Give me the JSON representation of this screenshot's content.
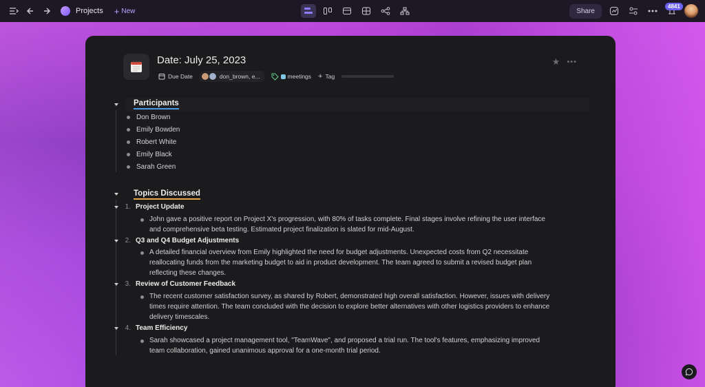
{
  "topbar": {
    "project_label": "Projects",
    "new_label": "New",
    "share_label": "Share",
    "notification_count": "4841"
  },
  "document": {
    "title": "Date: July 25, 2023",
    "properties": {
      "due_date_label": "Due Date",
      "assignees_label": "don_brown, e...",
      "tag_value": "meetings",
      "add_tag_label": "Tag"
    },
    "sections": [
      {
        "heading": "Participants",
        "items": [
          "Don Brown",
          "Emily Bowden",
          "Robert White",
          "Emily Black",
          "Sarah Green"
        ]
      },
      {
        "heading": "Topics Discussed",
        "topics": [
          {
            "number": "1.",
            "title": "Project Update",
            "lines": [
              "John gave a positive report on Project X's progression, with 80% of tasks complete. Final stages involve refining the user interface",
              "and comprehensive beta testing. Estimated project finalization is slated for mid-August."
            ]
          },
          {
            "number": "2.",
            "title": "Q3 and Q4 Budget Adjustments",
            "lines": [
              "A detailed financial overview from Emily highlighted the need for budget adjustments. Unexpected costs from Q2 necessitate",
              "reallocating funds from the marketing budget to aid in product development. The team agreed to submit a revised budget plan",
              "reflecting these changes."
            ]
          },
          {
            "number": "3.",
            "title": "Review of Customer Feedback",
            "lines": [
              "The recent customer satisfaction survey, as shared by Robert, demonstrated high overall satisfaction. However, issues with delivery",
              "times require attention. The team concluded with the decision to explore better alternatives with other logistics providers to enhance",
              "delivery timescales."
            ]
          },
          {
            "number": "4.",
            "title": "Team Efficiency",
            "lines": [
              "Sarah showcased a project management tool, \"TeamWave\", and proposed a trial run. The tool's features, emphasizing improved",
              "team collaboration, gained unanimous approval for a one-month trial period."
            ]
          }
        ]
      }
    ]
  },
  "colors": {
    "accent": "#6c62f2",
    "participants_underline": "#4a9ee8",
    "topics_underline": "#e8a94a"
  }
}
